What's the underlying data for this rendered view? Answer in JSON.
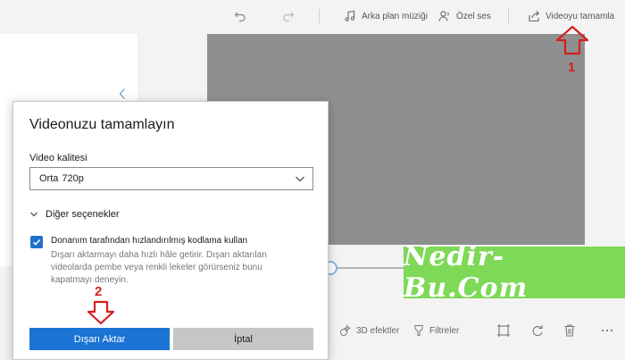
{
  "toolbar": {
    "bg_music": "Arka plan müziği",
    "custom_audio": "Özel ses",
    "finish_video": "Videoyu tamamla"
  },
  "dialog": {
    "title": "Videonuzu tamamlayın",
    "quality_label": "Video kalitesi",
    "quality_main": "Orta",
    "quality_sub": "720p",
    "more_options": "Diğer seçenekler",
    "hw_accel_label": "Donanım tarafından hızlandırılmış kodlama kullan",
    "hw_accel_checked": true,
    "hw_accel_desc": "Dışarı aktarmayı daha hızlı hâle getirir. Dışarı aktarılan videolarda pembe veya renkli lekeler görürseniz bunu kapatmayı deneyin.",
    "export_button": "Dışarı Aktar",
    "cancel_button": "İptal"
  },
  "bottom_toolbar": {
    "effects": "3D efektler",
    "filters": "Filtreler"
  },
  "watermark": "Nedir-Bu.Com",
  "annotations": {
    "step1": "1",
    "step2": "2"
  },
  "colors": {
    "accent": "#1b73d4",
    "annotation_red": "#d51f1f",
    "watermark_green": "#7ed957",
    "preview_gray": "#8f8f8f"
  },
  "icons": {
    "undo": "undo-icon",
    "redo": "redo-icon",
    "music": "music-note-icon",
    "custom_audio": "voice-icon",
    "share": "share-icon",
    "collapse": "chevron-left-icon",
    "dropdown": "chevron-down-icon",
    "expander": "chevron-down-icon",
    "check": "check-icon",
    "effects": "3d-effects-icon",
    "filters": "filter-icon",
    "crop": "crop-icon",
    "rotate": "rotate-icon",
    "delete": "trash-icon"
  }
}
